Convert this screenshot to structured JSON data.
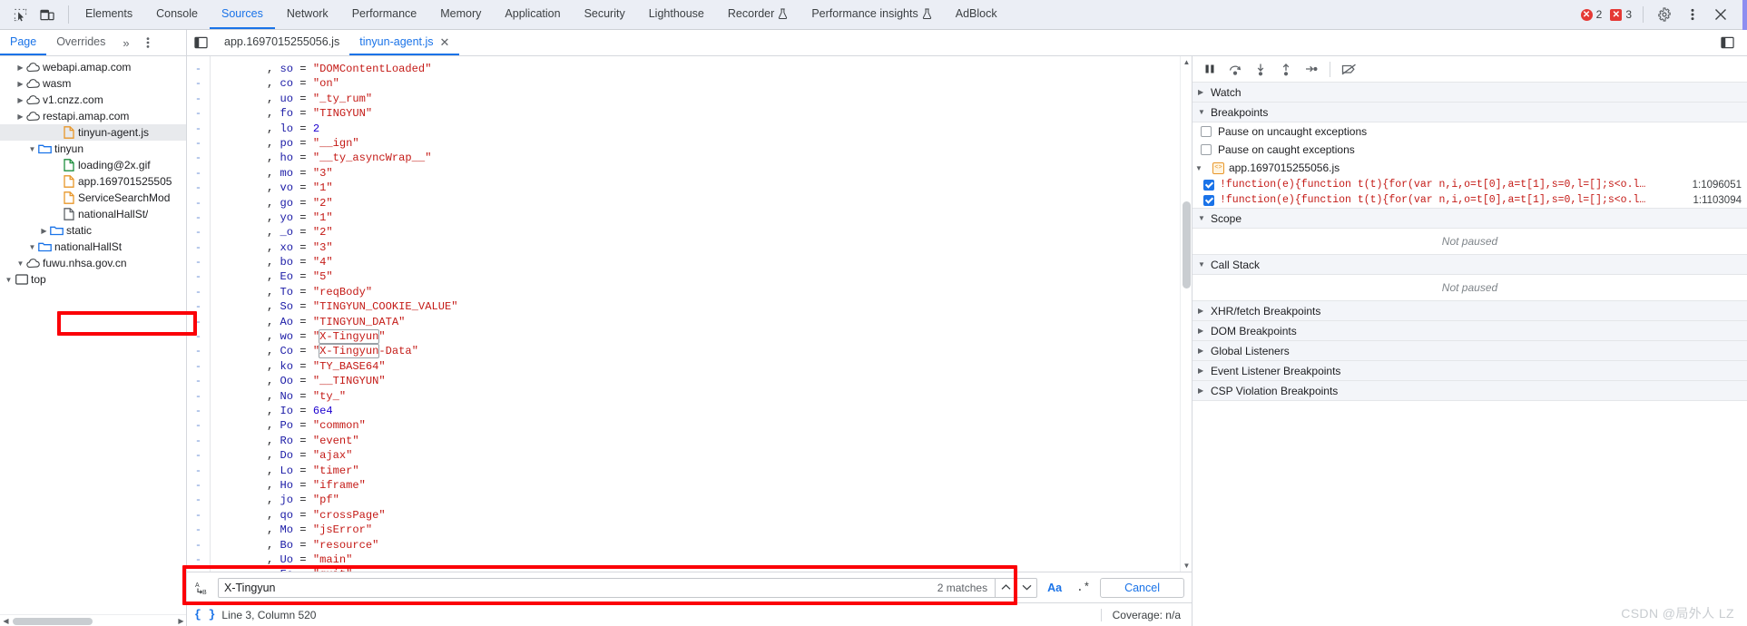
{
  "topbar": {
    "icons": [
      {
        "name": "inspect-element-icon",
        "glyph": "inspect"
      },
      {
        "name": "device-toolbar-icon",
        "glyph": "device"
      }
    ],
    "tabs": [
      {
        "label": "Elements",
        "active": false,
        "experimental": false
      },
      {
        "label": "Console",
        "active": false,
        "experimental": false
      },
      {
        "label": "Sources",
        "active": true,
        "experimental": false
      },
      {
        "label": "Network",
        "active": false,
        "experimental": false
      },
      {
        "label": "Performance",
        "active": false,
        "experimental": false
      },
      {
        "label": "Memory",
        "active": false,
        "experimental": false
      },
      {
        "label": "Application",
        "active": false,
        "experimental": false
      },
      {
        "label": "Security",
        "active": false,
        "experimental": false
      },
      {
        "label": "Lighthouse",
        "active": false,
        "experimental": false
      },
      {
        "label": "Recorder",
        "active": false,
        "experimental": true
      },
      {
        "label": "Performance insights",
        "active": false,
        "experimental": true
      },
      {
        "label": "AdBlock",
        "active": false,
        "experimental": false
      }
    ],
    "error_count": "2",
    "warning_count": "3",
    "error_glyph": "✕",
    "warning_glyph": "✕",
    "settings_label": "gear-icon",
    "menu_label": "⋮",
    "close_label": "✕"
  },
  "navpane": {
    "tabs": [
      {
        "label": "Page",
        "active": true
      },
      {
        "label": "Overrides",
        "active": false
      }
    ],
    "more_label": "»",
    "kebab_label": "⋮"
  },
  "editor_tabs": [
    {
      "label": "app.1697015255056.js",
      "active": false,
      "closable": false
    },
    {
      "label": "tinyun-agent.js",
      "active": true,
      "closable": true,
      "close_glyph": "✕"
    }
  ],
  "filetree": [
    {
      "label": "top",
      "depth": 0,
      "icon": "frame",
      "arrow": "down",
      "selected": false
    },
    {
      "label": "fuwu.nhsa.gov.cn",
      "depth": 1,
      "icon": "cloud",
      "arrow": "down",
      "selected": false
    },
    {
      "label": "nationalHallSt",
      "depth": 2,
      "icon": "folder-blue",
      "arrow": "down",
      "selected": false
    },
    {
      "label": "static",
      "depth": 3,
      "icon": "folder-blue",
      "arrow": "right",
      "selected": false
    },
    {
      "label": "nationalHallSt/",
      "depth": 4,
      "icon": "file-gray",
      "arrow": "none",
      "selected": false
    },
    {
      "label": "ServiceSearchMod",
      "depth": 4,
      "icon": "file-orange",
      "arrow": "none",
      "selected": false
    },
    {
      "label": "app.169701525505",
      "depth": 4,
      "icon": "file-orange",
      "arrow": "none",
      "selected": false
    },
    {
      "label": "loading@2x.gif",
      "depth": 4,
      "icon": "file-green",
      "arrow": "none",
      "selected": false
    },
    {
      "label": "tinyun",
      "depth": 2,
      "icon": "folder-blue",
      "arrow": "down",
      "selected": false
    },
    {
      "label": "tinyun-agent.js",
      "depth": 4,
      "icon": "file-orange",
      "arrow": "none",
      "selected": true
    },
    {
      "label": "restapi.amap.com",
      "depth": 1,
      "icon": "cloud",
      "arrow": "right",
      "selected": false
    },
    {
      "label": "v1.cnzz.com",
      "depth": 1,
      "icon": "cloud",
      "arrow": "right",
      "selected": false
    },
    {
      "label": "wasm",
      "depth": 1,
      "icon": "cloud",
      "arrow": "right",
      "selected": false
    },
    {
      "label": "webapi.amap.com",
      "depth": 1,
      "icon": "cloud",
      "arrow": "right",
      "selected": false
    }
  ],
  "code_lines": [
    {
      "var": "so",
      "value": "\"DOMContentLoaded\"",
      "type": "string"
    },
    {
      "var": "co",
      "value": "\"on\"",
      "type": "string"
    },
    {
      "var": "uo",
      "value": "\"_ty_rum\"",
      "type": "string"
    },
    {
      "var": "fo",
      "value": "\"TINGYUN\"",
      "type": "string"
    },
    {
      "var": "lo",
      "value": "2",
      "type": "number"
    },
    {
      "var": "po",
      "value": "\"__ign\"",
      "type": "string"
    },
    {
      "var": "ho",
      "value": "\"__ty_asyncWrap__\"",
      "type": "string"
    },
    {
      "var": "mo",
      "value": "\"3\"",
      "type": "string"
    },
    {
      "var": "vo",
      "value": "\"1\"",
      "type": "string"
    },
    {
      "var": "go",
      "value": "\"2\"",
      "type": "string"
    },
    {
      "var": "yo",
      "value": "\"1\"",
      "type": "string"
    },
    {
      "var": "_o",
      "value": "\"2\"",
      "type": "string"
    },
    {
      "var": "xo",
      "value": "\"3\"",
      "type": "string"
    },
    {
      "var": "bo",
      "value": "\"4\"",
      "type": "string"
    },
    {
      "var": "Eo",
      "value": "\"5\"",
      "type": "string"
    },
    {
      "var": "To",
      "value": "\"reqBody\"",
      "type": "string"
    },
    {
      "var": "So",
      "value": "\"TINGYUN_COOKIE_VALUE\"",
      "type": "string"
    },
    {
      "var": "Ao",
      "value": "\"TINGYUN_DATA\"",
      "type": "string"
    },
    {
      "var": "wo",
      "value": "\"X-Tingyun\"",
      "type": "string",
      "highlight": true,
      "match": "X-Tingyun"
    },
    {
      "var": "Co",
      "value": "\"X-Tingyun-Data\"",
      "type": "string",
      "match": "X-Tingyun"
    },
    {
      "var": "ko",
      "value": "\"TY_BASE64\"",
      "type": "string"
    },
    {
      "var": "Oo",
      "value": "\"__TINGYUN\"",
      "type": "string"
    },
    {
      "var": "No",
      "value": "\"ty_\"",
      "type": "string"
    },
    {
      "var": "Io",
      "value": "6e4",
      "type": "number"
    },
    {
      "var": "Po",
      "value": "\"common\"",
      "type": "string"
    },
    {
      "var": "Ro",
      "value": "\"event\"",
      "type": "string"
    },
    {
      "var": "Do",
      "value": "\"ajax\"",
      "type": "string"
    },
    {
      "var": "Lo",
      "value": "\"timer\"",
      "type": "string"
    },
    {
      "var": "Ho",
      "value": "\"iframe\"",
      "type": "string"
    },
    {
      "var": "jo",
      "value": "\"pf\"",
      "type": "string"
    },
    {
      "var": "qo",
      "value": "\"crossPage\"",
      "type": "string"
    },
    {
      "var": "Mo",
      "value": "\"jsError\"",
      "type": "string"
    },
    {
      "var": "Bo",
      "value": "\"resource\"",
      "type": "string"
    },
    {
      "var": "Uo",
      "value": "\"main\"",
      "type": "string"
    },
    {
      "var": "Fo",
      "value": "\"quit\"",
      "type": "string"
    }
  ],
  "search": {
    "value": "X-Tingyun",
    "placeholder": "Find",
    "matches_label": "2 matches",
    "prev_glyph": "∧",
    "next_glyph": "∨",
    "case_label": "Aa",
    "regex_label": ".*",
    "cancel_label": "Cancel",
    "replace_icon_top": "A",
    "replace_icon_bottom": "B"
  },
  "statusbar": {
    "pretty_print_glyph": "{ }",
    "position": "Line 3, Column 520",
    "coverage": "Coverage: n/a"
  },
  "debugger": {
    "toolbar": [
      {
        "name": "resume-script-icon",
        "glyph": "pause"
      },
      {
        "name": "step-over-icon",
        "glyph": "step-over"
      },
      {
        "name": "step-into-icon",
        "glyph": "step-into"
      },
      {
        "name": "step-out-icon",
        "glyph": "step-out"
      },
      {
        "name": "step-icon",
        "glyph": "step"
      },
      {
        "name": "deactivate-breakpoints-icon",
        "glyph": "deactivate"
      }
    ],
    "sections": [
      {
        "title": "Watch",
        "expanded": false
      },
      {
        "title": "Breakpoints",
        "expanded": true
      },
      {
        "title": "Scope",
        "expanded": true,
        "body": "Not paused"
      },
      {
        "title": "Call Stack",
        "expanded": true,
        "body": "Not paused"
      },
      {
        "title": "XHR/fetch Breakpoints",
        "expanded": false
      },
      {
        "title": "DOM Breakpoints",
        "expanded": false
      },
      {
        "title": "Global Listeners",
        "expanded": false
      },
      {
        "title": "Event Listener Breakpoints",
        "expanded": false
      },
      {
        "title": "CSP Violation Breakpoints",
        "expanded": false
      }
    ],
    "pause_uncaught": {
      "label": "Pause on uncaught exceptions",
      "checked": false
    },
    "pause_caught": {
      "label": "Pause on caught exceptions",
      "checked": false
    },
    "bp_file": "app.1697015255056.js",
    "breakpoints": [
      {
        "code": "!function(e){function t(t){for(var n,i,o=t[0],a=t[1],s=0,l=[];s<o.l…",
        "location": "1:1096051",
        "checked": true
      },
      {
        "code": "!function(e){function t(t){for(var n,i,o=t[0],a=t[1],s=0,l=[];s<o.l…",
        "location": "1:1103094",
        "checked": true
      }
    ],
    "not_paused_label": "Not paused"
  },
  "watermark": "CSDN @局外人 LZ",
  "colors": {
    "accent": "#1a73e8",
    "annotation_red": "#fb0007",
    "error_red": "#e53935",
    "toolbar_bg": "#ebeef5",
    "string_red": "#c41a16",
    "var_blue": "#1a1aa6"
  }
}
